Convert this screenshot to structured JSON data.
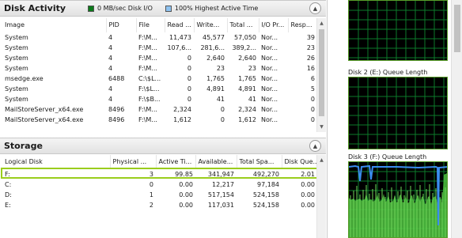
{
  "disk_activity": {
    "title": "Disk Activity",
    "io_badge": "0 MB/sec Disk I/O",
    "active_badge": "100% Highest Active Time",
    "columns": [
      "Image",
      "PID",
      "File",
      "Read ...",
      "Write...",
      "Total ...",
      "I/O Pr...",
      "Resp..."
    ],
    "rows": [
      [
        "System",
        "4",
        "F:\\M...",
        "11,473",
        "45,577",
        "57,050",
        "Nor...",
        "39"
      ],
      [
        "System",
        "4",
        "F:\\M...",
        "107,6...",
        "281,6...",
        "389,2...",
        "Nor...",
        "23"
      ],
      [
        "System",
        "4",
        "F:\\M...",
        "0",
        "2,640",
        "2,640",
        "Nor...",
        "26"
      ],
      [
        "System",
        "4",
        "F:\\M...",
        "0",
        "23",
        "23",
        "Nor...",
        "16"
      ],
      [
        "msedge.exe",
        "6488",
        "C:\\$L...",
        "0",
        "1,765",
        "1,765",
        "Nor...",
        "6"
      ],
      [
        "System",
        "4",
        "F:\\$L...",
        "0",
        "4,891",
        "4,891",
        "Nor...",
        "5"
      ],
      [
        "System",
        "4",
        "F:\\$B...",
        "0",
        "41",
        "41",
        "Nor...",
        "0"
      ],
      [
        "MailStoreServer_x64.exe",
        "8496",
        "F:\\M...",
        "2,324",
        "0",
        "2,324",
        "Nor...",
        "0"
      ],
      [
        "MailStoreServer_x64.exe",
        "8496",
        "F:\\M...",
        "1,612",
        "0",
        "1,612",
        "Nor...",
        "0"
      ]
    ]
  },
  "storage": {
    "title": "Storage",
    "columns": [
      "Logical Disk",
      "Physical ...",
      "Active Ti...",
      "Available...",
      "Total Spa...",
      "Disk Que..."
    ],
    "rows": [
      [
        "F:",
        "3",
        "99.85",
        "341,947",
        "492,270",
        "2.01"
      ],
      [
        "C:",
        "0",
        "0.00",
        "12,217",
        "97,184",
        "0.00"
      ],
      [
        "D:",
        "1",
        "0.00",
        "517,154",
        "524,158",
        "0.00"
      ],
      [
        "E:",
        "2",
        "0.00",
        "117,031",
        "524,158",
        "0.00"
      ]
    ],
    "highlighted_row": 0
  },
  "graphs": {
    "disk2_caption": "Disk 2 (E:) Queue Length",
    "disk3_caption": "Disk 3 (F:) Queue Length"
  },
  "colors": {
    "grid_line": "#0d7a2a",
    "graph_line": "#3b8df0",
    "graph_fill": "#4fc23f",
    "highlight": "#9acd1d"
  }
}
